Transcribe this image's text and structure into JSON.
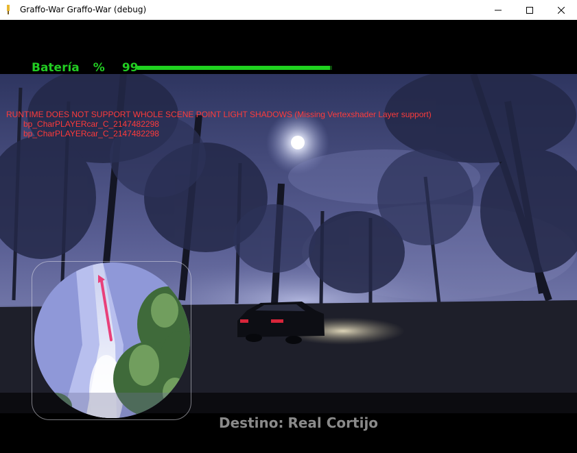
{
  "window": {
    "title": "Graffo-War Graffo-War (debug)",
    "controls": [
      "minimize",
      "maximize",
      "close"
    ]
  },
  "hud": {
    "battery_label": "Batería",
    "battery_percent_sign": "%",
    "battery_value": "99",
    "battery_level": 0.99,
    "battery_color": "#1fd21f"
  },
  "debug_messages": [
    "RUNTIME DOES NOT SUPPORT WHOLE SCENE POINT LIGHT SHADOWS (Missing Vertexshader Layer support)",
    "bp_CharPLAYERcar_C_2147482298",
    "bp_CharPLAYERcar_C_2147482298"
  ],
  "destination": {
    "label": "Destino:",
    "name": "Real Cortijo"
  },
  "colors": {
    "hud_green": "#22cc22",
    "debug_red": "#ff3b3b",
    "destination_gray": "#8a8a8a",
    "minimap_arrow": "#e8407a"
  },
  "icons": [
    "app-icon",
    "minimize-icon",
    "maximize-icon",
    "close-icon",
    "player-arrow-icon"
  ]
}
